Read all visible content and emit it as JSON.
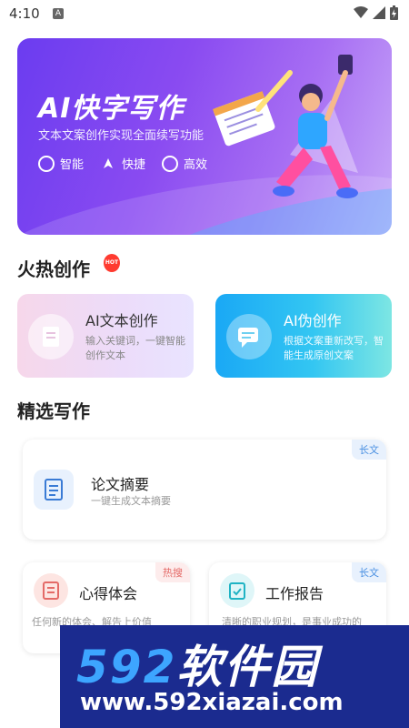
{
  "status_bar": {
    "time": "4:10",
    "notif_letter": "A"
  },
  "banner": {
    "title": "AI快字写作",
    "subtitle": "文本文案创作实现全面续写功能",
    "features": [
      {
        "label": "智能",
        "icon": "smart-icon"
      },
      {
        "label": "快捷",
        "icon": "rocket-icon"
      },
      {
        "label": "高效",
        "icon": "speed-icon"
      }
    ]
  },
  "hot_section": {
    "title": "火热创作",
    "badge": "HOT",
    "cards": [
      {
        "name": "AI文本创作",
        "desc": "输入关键词，一键智能创作文本"
      },
      {
        "name": "AI伪创作",
        "desc": "根据文案重新改写，智能生成原创文案"
      }
    ]
  },
  "selected_section": {
    "title": "精选写作",
    "cards": [
      {
        "name": "论文摘要",
        "desc": "一键生成文本摘要",
        "tag": "长文"
      },
      {
        "name": "心得体会",
        "desc": "任何新的体会、解告上价值",
        "tag": "热搜"
      },
      {
        "name": "工作报告",
        "desc": "清晰的职业规划，是事业成功的",
        "tag": "长文"
      }
    ]
  },
  "watermark": {
    "brand_num": "592",
    "brand_text": "软件园",
    "url": "www.592xiazai.com"
  },
  "colors": {
    "banner_start": "#6b3cf0",
    "card2_start": "#1aa8f5",
    "tag_blue": "#4a90e2",
    "tag_red": "#e46a67"
  }
}
